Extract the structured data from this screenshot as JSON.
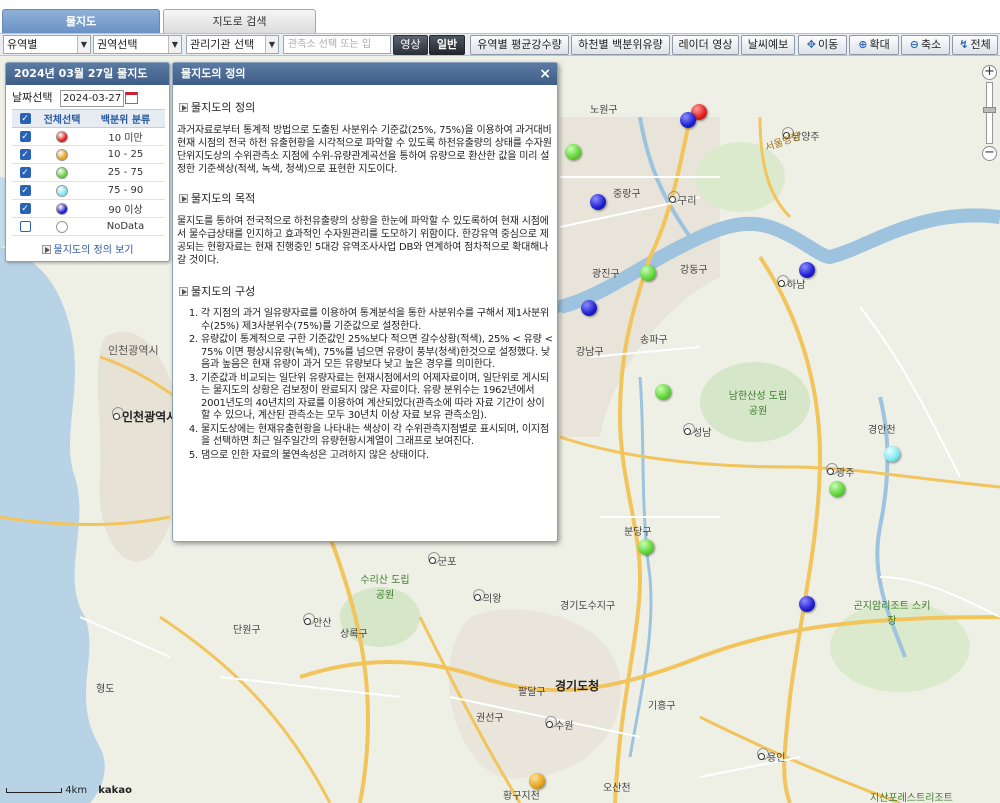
{
  "tabs": [
    {
      "label": "물지도",
      "active": true
    },
    {
      "label": "지도로 검색",
      "active": false
    }
  ],
  "toolbar": {
    "basin_select": "유역별",
    "region_select": "권역선택",
    "agency_select": "관리기관 선택",
    "search_placeholder": "관측소 선택 또는 입",
    "btn_satellite": "영상",
    "btn_normal": "일반",
    "btn_basin_rain": "유역별 평균강수량",
    "btn_river_pct": "하천별 백분위유량",
    "btn_radar": "레이더 영상",
    "btn_forecast": "날씨예보",
    "btn_move": "이동",
    "btn_zoom_in": "확대",
    "btn_zoom_out": "축소",
    "btn_full": "전체"
  },
  "legend": {
    "title": "2024년 03월 27일 물지도",
    "date_label": "날짜선택",
    "date_value": "2024-03-27",
    "col_select": "전체선택",
    "col_class": "백분위 분류",
    "rows": [
      {
        "checked": true,
        "color": "#e02020",
        "label": "10 미만"
      },
      {
        "checked": true,
        "color": "#e6a21d",
        "label": "10 - 25"
      },
      {
        "checked": true,
        "color": "#5fd33a",
        "label": "25 - 75"
      },
      {
        "checked": true,
        "color": "#7fe6f0",
        "label": "75 - 90"
      },
      {
        "checked": true,
        "color": "#1d1dd1",
        "label": "90 이상"
      },
      {
        "checked": false,
        "color": "#ffffff",
        "label": "NoData"
      }
    ],
    "view_link": "물지도의 정의 보기"
  },
  "popup": {
    "title": "물지도의 정의",
    "close": "×",
    "sections": [
      {
        "heading": "물지도의 정의",
        "text": "과거자료로부터 통계적 방법으로 도출된 사분위수 기준값(25%, 75%)을 이용하여 과거대비 현재 시점의 전국 하천 유출현황을 시각적으로 파악할 수 있도록 하천유출량의 상태를 수자원단위지도상의 수위관측소 지점에 수위-유량관계곡선을 통하여 유량으로 환산한 값을 미리 설정한 기준색상(적색, 녹색, 청색)으로 표현한 지도이다."
      },
      {
        "heading": "물지도의 목적",
        "text": "물지도를 통하여 전국적으로 하천유출량의 상황을 한눈에 파악할 수 있도록하여 현재 시점에서 물수급상태를 인지하고 효과적인 수자원관리를 도모하기 위함이다. 한강유역 중심으로 제공되는 현황자료는 현재 진행중인 5대강 유역조사사업 DB와 연계하여 점차적으로 확대해나갈 것이다."
      },
      {
        "heading": "물지도의 구성",
        "items": [
          "각 지점의 과거 일유량자료를 이용하여 통계분석을 통한 사분위수를 구해서 제1사분위수(25%) 제3사분위수(75%)를 기준값으로 설정한다.",
          "유량값이 통계적으로 구한 기준값인 25%보다 적으면 갈수상황(적색), 25% < 유량 < 75% 이면 평상시유량(녹색), 75%를 넘으면 유량이 풍부(청색)한것으로 설정했다. 낮음과 높음은 현재 유량이 과거 모든 유량보다 낮고 높은 경우를 의미한다.",
          "기준값과 비교되는 일단위 유량자료는 현재시점에서의 어제자료이며, 일단위로 게시되는 물지도의 상황은 검보정이 완료되지 않은 자료이다. 유량 분위수는 1962년에서 2001년도의 40년치의 자료를 이용하여 계산되었다(관측소에 따라 자료 기간이 상이 할 수 있으나, 계산된 관측소는 모두 30년치 이상 자료 보유 관측소임).",
          "물지도상에는 현재유출현황을 나타내는 색상이 각 수위관측지점별로 표시되며, 이지점을 선택하면 최근 일주일간의 유량현황시계열이 그래프로 보여진다.",
          "댐으로 인한 자료의 불연속성은 고려하지 않은 상태이다."
        ]
      }
    ]
  },
  "map": {
    "labels": {
      "namyangju": "남양주",
      "guri": "구리",
      "hanam": "하남",
      "seongnam": "성남",
      "gwangju": "광주",
      "incheon": "인천광역시",
      "incheon_city": "인천광역시",
      "ansan": "안산",
      "suwon": "수원",
      "yongin": "용인",
      "gyeonggi": "경기도청",
      "gunpo": "군포",
      "uiwang": "의왕",
      "nowon": "노원구",
      "gangdong": "강동구",
      "gangnam": "강남구",
      "songpa": "송파구",
      "jungrang": "중랑구",
      "gwangjin": "광진구",
      "bundang": "분당구",
      "jiksan": "남한산성 도립공원",
      "gonjiam": "곤지암리조트 스키장",
      "gyeonggi_sujiguan": "경기도수지구",
      "suri": "수리산 도립공원",
      "danwon": "단원구",
      "sangnok": "상록구",
      "gwonseon": "권선구",
      "paldal": "팔달구",
      "giheung": "기흥구",
      "seosan": "서울방향",
      "hwanggu": "황구지천",
      "osan": "오산천",
      "jisan": "지산포레스트리조트",
      "gyeongan": "경안천",
      "hyeongdo": "형도"
    },
    "scale_label": "4km",
    "brand": "kakao"
  },
  "stations": [
    {
      "color": "red"
    },
    {
      "color": "blue"
    },
    {
      "color": "green"
    },
    {
      "color": "blue"
    },
    {
      "color": "green"
    },
    {
      "color": "blue"
    },
    {
      "color": "blue"
    },
    {
      "color": "green"
    },
    {
      "color": "cyan"
    },
    {
      "color": "green"
    },
    {
      "color": "green"
    },
    {
      "color": "blue"
    },
    {
      "color": "orange"
    },
    {
      "color": "blue"
    }
  ]
}
